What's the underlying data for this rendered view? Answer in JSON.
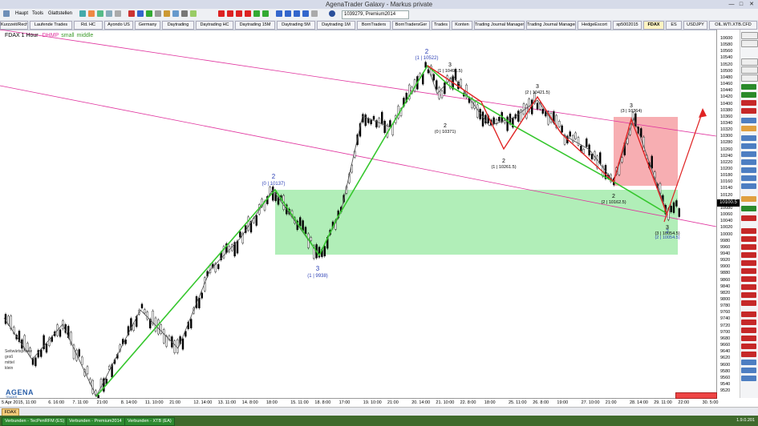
{
  "window": {
    "title": "AgenaTrader Galaxy - Markus private"
  },
  "menu": {
    "items": [
      "Haupt",
      "Tools",
      "Glattstellen"
    ],
    "account": "1039279, Premium2014"
  },
  "tabs": [
    "Kurzzeit/Rechtslage",
    "Laufende Trades",
    "Rd. HC",
    "Ayondo US",
    "Germany",
    "Daytrading",
    "Daytrading HC",
    "Daytrading 15M",
    "Daytrading 5M",
    "Daytrading 1M",
    "BornTraders",
    "BornTradersGer",
    "Trades",
    "Konten",
    "Trading Journal Manager",
    "Trading Journal Manager",
    "HedgeEscort",
    "sp5002015",
    "FDAX",
    "ES",
    "USDJPY",
    "OIL.WTI.XTB.CFD"
  ],
  "active_tab": "FDAX",
  "chart_info": {
    "symbol": "FDAX 1 Hour",
    "indicator": "DHMP",
    "small": "small",
    "middle": "middle"
  },
  "price_axis": {
    "labels": [
      "10600",
      "10580",
      "10560",
      "10540",
      "10520",
      "10500",
      "10480",
      "10460",
      "10440",
      "10420",
      "10400",
      "10380",
      "10360",
      "10340",
      "10320",
      "10300",
      "10280",
      "10260",
      "10240",
      "10220",
      "10200",
      "10180",
      "10160",
      "10140",
      "10120",
      "10100",
      "10080",
      "10060",
      "10040",
      "10020",
      "10000",
      "9980",
      "9960",
      "9940",
      "9920",
      "9900",
      "9880",
      "9860",
      "9840",
      "9820",
      "9800",
      "9780",
      "9760",
      "9740",
      "9720",
      "9700",
      "9680",
      "9660",
      "9640",
      "9620",
      "9600",
      "9580",
      "9560",
      "9540",
      "9520"
    ],
    "current_price": "10100.5"
  },
  "time_axis": [
    "5 Apr 2015, 11:00",
    "6. 16:00",
    "7. 11:00",
    "21:00",
    "8. 14:00",
    "11. 10:00",
    "21:00",
    "12. 14:00",
    "13. 11:00",
    "14. 8:00",
    "18:00",
    "15. 11:00",
    "18. 8:00",
    "17:00",
    "19. 10:00",
    "21:00",
    "20. 14:00",
    "21. 10:00",
    "22. 8:00",
    "18:00",
    "25. 11:00",
    "26. 8:00",
    "19:00",
    "27. 10:00",
    "21:00",
    "28. 14:00",
    "29. 11:00",
    "22:00",
    "30. 5:00"
  ],
  "annotations": [
    {
      "wave": "2",
      "label": "(0 | 10137)",
      "wave_color": "#2b3fb5"
    },
    {
      "wave": "3",
      "label": "(1 | 9938)",
      "wave_color": "#2b3fb5"
    },
    {
      "wave": "2",
      "label": "(1 | 10522)",
      "wave_color": "#2b3fb5"
    },
    {
      "wave": "3",
      "label": "(1 | 10491.5)",
      "wave_color": "#000000"
    },
    {
      "wave": "2",
      "label": "(0 | 10371)",
      "wave_color": "#000000"
    },
    {
      "wave": "3",
      "label": "(2 | 10421.5)",
      "wave_color": "#000000"
    },
    {
      "wave": "2",
      "label": "(1 | 10261.5)",
      "wave_color": "#000000"
    },
    {
      "wave": "3",
      "label": "(3 | 10364)",
      "wave_color": "#000000"
    },
    {
      "wave": "2",
      "label": "(2 | 10162.5)",
      "wave_color": "#000000"
    },
    {
      "wave": "3",
      "label": "(3 | 10054.5)",
      "wave_color": "#000000"
    },
    {
      "wave": "2",
      "label": "(2 | 10054.5)",
      "wave_color": "#2b3fb5"
    }
  ],
  "left_legend": [
    "Seitwärtsphase",
    "groß",
    "mittel",
    "klein"
  ],
  "bottom_tab": "FDAX",
  "status": [
    "Verbunden - TecPenRFM (ES)",
    "Verbunden - Premium2014",
    "Verbunden - XTB (EA)"
  ],
  "version": "1.9.0.201",
  "colors": {
    "green_zone": "#a8ecb0",
    "red_zone": "#f7aaae",
    "channel": "#e0339e",
    "up_leg": "#36c72e",
    "down_leg": "#e02424"
  },
  "logo": {
    "name": "AGENA",
    "sub": "TRADER"
  }
}
